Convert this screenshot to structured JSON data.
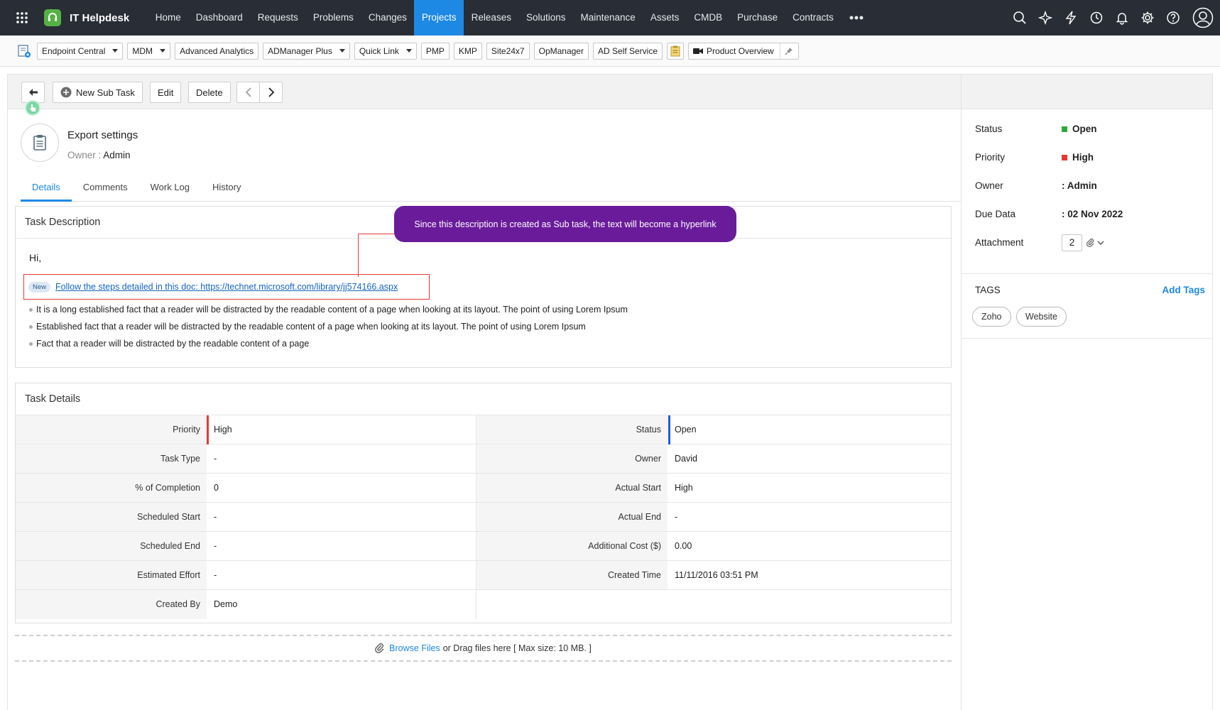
{
  "topnav": {
    "app_name": "IT Helpdesk",
    "items": [
      {
        "label": "Home"
      },
      {
        "label": "Dashboard"
      },
      {
        "label": "Requests"
      },
      {
        "label": "Problems"
      },
      {
        "label": "Changes"
      },
      {
        "label": "Projects",
        "active": true
      },
      {
        "label": "Releases"
      },
      {
        "label": "Solutions"
      },
      {
        "label": "Maintenance"
      },
      {
        "label": "Assets"
      },
      {
        "label": "CMDB"
      },
      {
        "label": "Purchase"
      },
      {
        "label": "Contracts"
      }
    ],
    "accent_color": "#1e88e5",
    "icons": [
      "search-icon",
      "sparkle-icon",
      "lightning-icon",
      "history-icon",
      "bell-icon",
      "gear-icon",
      "help-icon",
      "user-avatar-icon"
    ]
  },
  "toolbar": {
    "buttons": [
      {
        "label": "Endpoint Central",
        "dropdown": true
      },
      {
        "label": "MDM",
        "dropdown": true
      },
      {
        "label": "Advanced Analytics",
        "dropdown": false
      },
      {
        "label": "ADManager Plus",
        "dropdown": true
      },
      {
        "label": "Quick Link",
        "dropdown": true
      },
      {
        "label": "PMP",
        "dropdown": false
      },
      {
        "label": "KMP",
        "dropdown": false
      },
      {
        "label": "Site24x7",
        "dropdown": false
      },
      {
        "label": "OpManager",
        "dropdown": false
      },
      {
        "label": "AD Self Service",
        "dropdown": false
      }
    ],
    "product_overview": "Product Overview"
  },
  "actionbar": {
    "new_sub_task": "New Sub Task",
    "edit": "Edit",
    "delete": "Delete"
  },
  "task": {
    "title": "Export settings",
    "owner_label": "Owner :",
    "owner_value": "Admin"
  },
  "tabs": [
    {
      "label": "Details",
      "active": true
    },
    {
      "label": "Comments"
    },
    {
      "label": "Work Log"
    },
    {
      "label": "History"
    }
  ],
  "description": {
    "title": "Task Description",
    "greeting": "Hi,",
    "badge": "New",
    "link_text": "Follow the steps detailed in this doc: https://technet.microsoft.com/library/jj574166.aspx",
    "bullets": [
      "It is a long established fact that a reader will be distracted by the readable content of a page when looking at its layout. The point of using Lorem Ipsum",
      "Established fact that a reader will be distracted by the readable content of a page when looking at its layout. The point of using Lorem Ipsum",
      "Fact that a reader will be distracted by the readable content of a page"
    ],
    "callout": "Since this description is created as Sub task, the text will become a hyperlink"
  },
  "details": {
    "title": "Task Details",
    "rows": [
      {
        "l1": "Priority",
        "v1": "High",
        "l2": "Status",
        "v2": "Open"
      },
      {
        "l1": "Task Type",
        "v1": "-",
        "l2": "Owner",
        "v2": "David"
      },
      {
        "l1": "% of Completion",
        "v1": "0",
        "l2": "Actual Start",
        "v2": "High"
      },
      {
        "l1": "Scheduled Start",
        "v1": "-",
        "l2": "Actual End",
        "v2": "-"
      },
      {
        "l1": "Scheduled End",
        "v1": "-",
        "l2": "Additional Cost ($)",
        "v2": "0.00"
      },
      {
        "l1": "Estimated Effort",
        "v1": "-",
        "l2": "Created Time",
        "v2": "11/11/2016 03:51 PM"
      },
      {
        "l1": "Created By",
        "v1": "Demo",
        "l2": "",
        "v2": ""
      }
    ],
    "priority_color": "#e53935",
    "status_color": "#1e5bd6"
  },
  "dropzone": {
    "browse": "Browse Files",
    "rest": "or Drag files here [ Max size: 10 MB. ]"
  },
  "side": {
    "status_label": "Status",
    "status_value": "Open",
    "status_color": "#2eaa3c",
    "priority_label": "Priority",
    "priority_value": "High",
    "priority_color": "#e53935",
    "owner_label": "Owner",
    "owner_value": ": Admin",
    "due_label": "Due Data",
    "due_value": ": 02 Nov 2022",
    "attachment_label": "Attachment",
    "attachment_count": "2",
    "tags_title": "TAGS",
    "add_tags": "Add Tags",
    "tags": [
      "Zoho",
      "Website"
    ]
  }
}
